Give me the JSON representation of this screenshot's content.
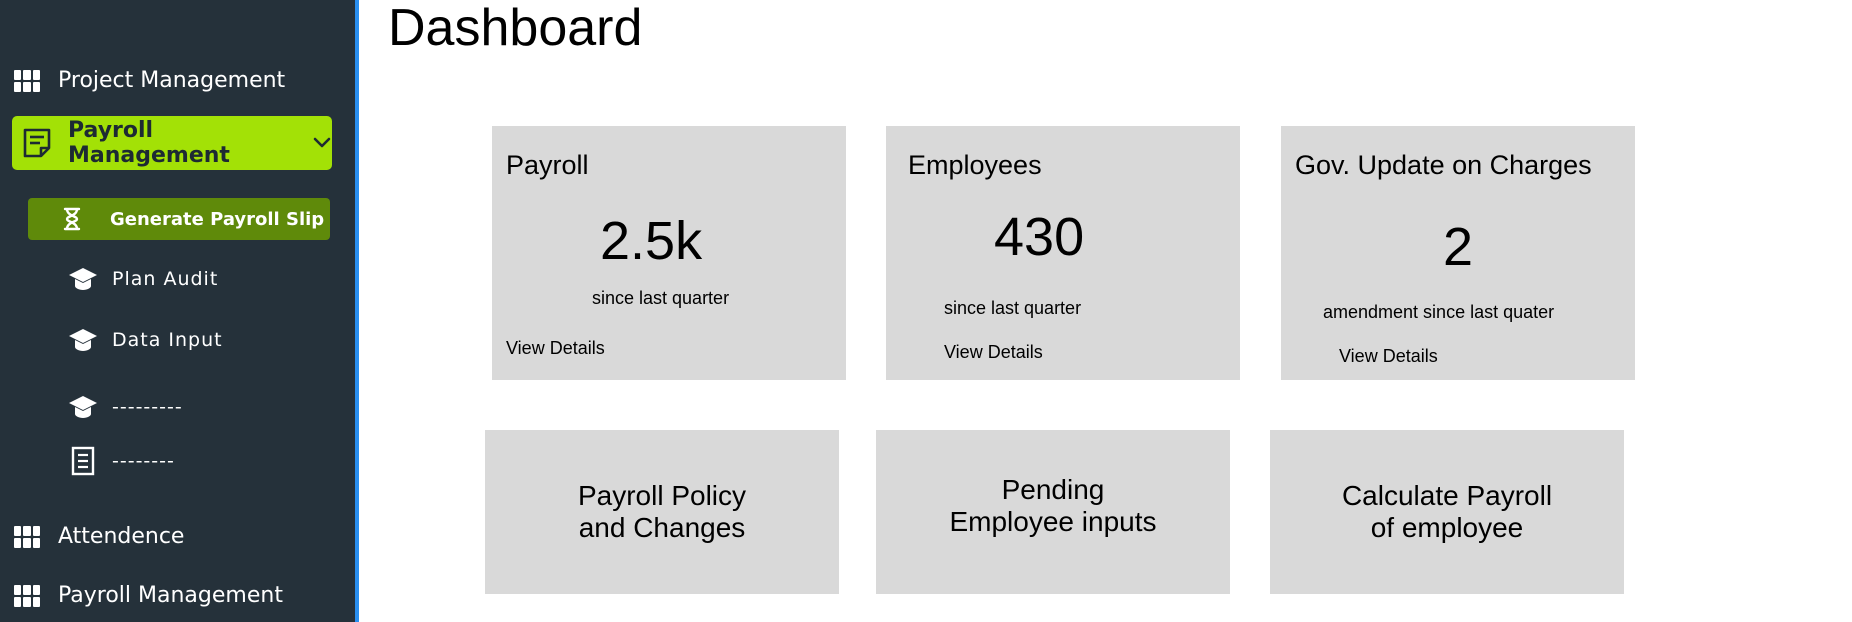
{
  "page": {
    "title": "Dashboard"
  },
  "sidebar": {
    "items": [
      {
        "label": "Project Management",
        "icon": "grid-icon"
      },
      {
        "label": "Payroll Management",
        "icon": "document-icon",
        "active": true,
        "expanded": true
      },
      {
        "label": "Attendence",
        "icon": "grid-icon"
      },
      {
        "label": "Payroll Management",
        "icon": "grid-icon"
      }
    ],
    "subitems": [
      {
        "label": "Generate Payroll Slip",
        "icon": "hourglass-icon",
        "active": true
      },
      {
        "label": "Plan Audit",
        "icon": "graduation-cap-icon"
      },
      {
        "label": "Data Input",
        "icon": "graduation-cap-icon"
      },
      {
        "label": "---------",
        "icon": "graduation-cap-icon"
      },
      {
        "label": "--------",
        "icon": "document-icon"
      }
    ],
    "colors": {
      "background": "#25313a",
      "active": "#a3e106",
      "sub_active": "#5f8a0a",
      "edge": "#2a8ff0"
    }
  },
  "stats": [
    {
      "title": "Payroll",
      "value": "2.5k",
      "caption": "since last quarter",
      "link": "View Details"
    },
    {
      "title": "Employees",
      "value": "430",
      "caption": "since last quarter",
      "link": "View Details"
    },
    {
      "title": "Gov. Update on Charges",
      "value": "2",
      "caption": "amendment since last quater",
      "link": "View Details"
    }
  ],
  "actions": [
    {
      "line1": "Payroll Policy",
      "line2": "and Changes"
    },
    {
      "line1": "Pending",
      "line2": "Employee inputs"
    },
    {
      "line1": "Calculate Payroll",
      "line2": "of employee"
    }
  ]
}
